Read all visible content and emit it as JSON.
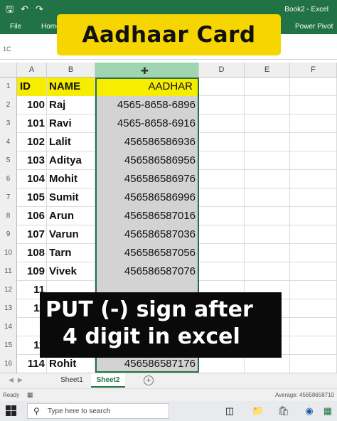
{
  "window": {
    "doc_title": "Book2 - Excel",
    "qat": {
      "save_icon": "save-icon",
      "undo_icon": "undo-icon",
      "redo_icon": "redo-icon"
    },
    "tabs": [
      "File",
      "Home",
      "Power Pivot"
    ]
  },
  "banner": {
    "text": "Aadhaar Card"
  },
  "formula_bar": {
    "name_box": "1C"
  },
  "grid": {
    "columns": [
      "A",
      "B",
      "C",
      "D",
      "E",
      "F"
    ],
    "selected_column": "C",
    "header_row": {
      "row_num": "1",
      "a": "ID",
      "b": "NAME",
      "c": "AADHAR"
    },
    "rows": [
      {
        "n": "2",
        "a": "100",
        "b": "Raj",
        "c": "4565-8658-6896"
      },
      {
        "n": "3",
        "a": "101",
        "b": "Ravi",
        "c": "4565-8658-6916"
      },
      {
        "n": "4",
        "a": "102",
        "b": "Lalit",
        "c": "456586586936"
      },
      {
        "n": "5",
        "a": "103",
        "b": "Aditya",
        "c": "456586586956"
      },
      {
        "n": "6",
        "a": "104",
        "b": "Mohit",
        "c": "456586586976"
      },
      {
        "n": "7",
        "a": "105",
        "b": "Sumit",
        "c": "456586586996"
      },
      {
        "n": "8",
        "a": "106",
        "b": "Arun",
        "c": "456586587016"
      },
      {
        "n": "9",
        "a": "107",
        "b": "Varun",
        "c": "456586587036"
      },
      {
        "n": "10",
        "a": "108",
        "b": "Tarn",
        "c": "456586587056"
      },
      {
        "n": "11",
        "a": "109",
        "b": "Vivek",
        "c": "456586587076"
      },
      {
        "n": "12",
        "a": "11",
        "b": "",
        "c": ""
      },
      {
        "n": "13",
        "a": "11",
        "b": "",
        "c": ""
      },
      {
        "n": "14",
        "a": "",
        "b": "",
        "c": ""
      },
      {
        "n": "15",
        "a": "11",
        "b": "",
        "c": ""
      },
      {
        "n": "16",
        "a": "114",
        "b": "Rohit",
        "c": "456586587176"
      }
    ]
  },
  "caption": {
    "line1": "PUT (-) sign after",
    "line2": "4 digit in excel"
  },
  "sheets": {
    "tab1": "Sheet1",
    "tab2": "Sheet2",
    "add": "+"
  },
  "status": {
    "ready": "Ready",
    "average": "Average: 45658658710"
  },
  "taskbar": {
    "search_placeholder": "Type here to search"
  }
}
